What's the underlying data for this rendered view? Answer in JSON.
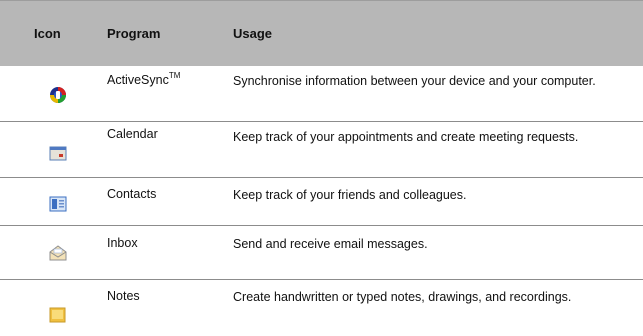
{
  "headers": {
    "icon": "Icon",
    "program": "Program",
    "usage": "Usage"
  },
  "rows": [
    {
      "icon": "activesync-icon",
      "program": "ActiveSync",
      "program_suffix": "TM",
      "usage": "Synchronise information between your device and your computer."
    },
    {
      "icon": "calendar-icon",
      "program": "Calendar",
      "usage": "Keep track of your appointments and create meeting requests."
    },
    {
      "icon": "contacts-icon",
      "program": "Contacts",
      "usage": "Keep track of your friends and colleagues."
    },
    {
      "icon": "inbox-icon",
      "program": "Inbox",
      "usage": "Send and receive email messages."
    },
    {
      "icon": "notes-icon",
      "program": "Notes",
      "usage": "Create handwritten or typed notes, drawings, and recordings."
    }
  ]
}
